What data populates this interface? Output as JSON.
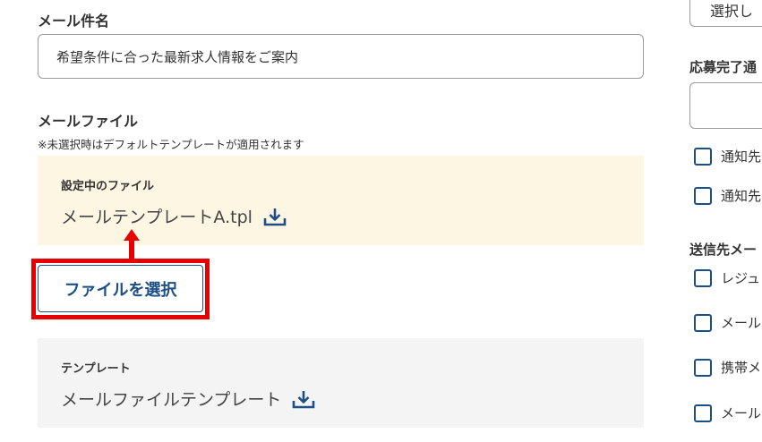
{
  "subject": {
    "label": "メール件名",
    "value": "希望条件に合った最新求人情報をご案内"
  },
  "mail_file": {
    "label": "メールファイル",
    "note": "※未選択時はデフォルトテンプレートが適用されます",
    "current_caption": "設定中のファイル",
    "current_file": "メールテンプレートA.tpl",
    "select_button": "ファイルを選択"
  },
  "template": {
    "caption": "テンプレート",
    "file": "メールファイルテンプレート"
  },
  "right_panel": {
    "select_button": "選択し",
    "completion_label": "応募完了通",
    "notify_checkboxes": [
      "通知先",
      "通知先"
    ],
    "recipient_label": "送信先メー",
    "recipient_checkboxes": [
      "レジュ",
      "メール",
      "携帯メ",
      "メール"
    ]
  },
  "colors": {
    "accent": "#1d4f86",
    "highlight": "#e60000",
    "file_box_bg": "#fdf6e3",
    "template_box_bg": "#f4f4f4"
  }
}
